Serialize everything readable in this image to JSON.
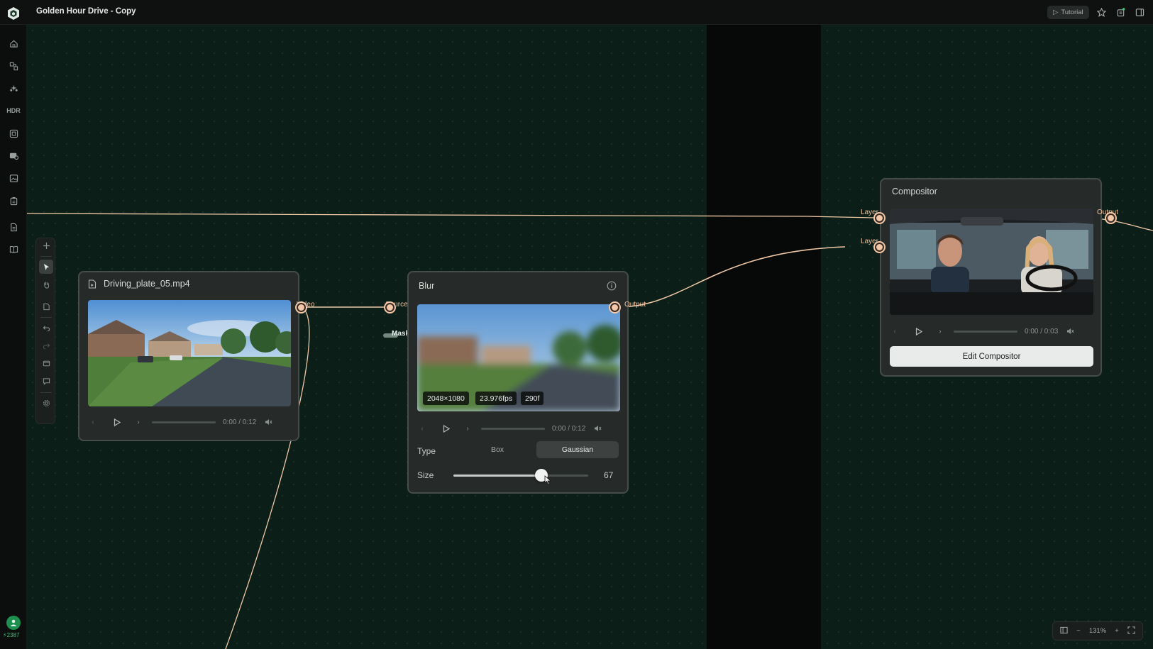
{
  "app": {
    "document_title": "Golden Hour Drive - Copy",
    "tutorial_label": "Tutorial",
    "credits": "2387"
  },
  "colors": {
    "canvas_bg": "#0b1f18",
    "wire": "#f0c8a6",
    "node_bg": "#262a28",
    "accent_green": "#1d8f4e"
  },
  "sidebar": {
    "items": [
      {
        "icon": "home-icon"
      },
      {
        "icon": "workflow-icon"
      },
      {
        "icon": "sparkle-nodes-icon"
      },
      {
        "icon": "hdr-icon",
        "label": "HDR"
      },
      {
        "icon": "frame-icon"
      },
      {
        "icon": "media-icon"
      },
      {
        "icon": "gallery-icon"
      },
      {
        "icon": "clipboard-icon"
      },
      {
        "icon": "document-icon"
      },
      {
        "icon": "book-icon"
      }
    ]
  },
  "nodes": {
    "video": {
      "title": "Driving_plate_05.mp4",
      "time": "0:00 / 0:12",
      "output_label": "Video"
    },
    "blur": {
      "title": "Blur",
      "source_label": "Source *",
      "mask_label": "Mask",
      "output_label": "Output",
      "badges": [
        "2048×1080",
        "23.976fps",
        "290f"
      ],
      "time": "0:00 / 0:12",
      "type_label": "Type",
      "type_options": [
        "Box",
        "Gaussian"
      ],
      "type_selected": "Gaussian",
      "size_label": "Size",
      "size_value": "67",
      "size_fraction": 0.65
    },
    "compositor": {
      "title": "Compositor",
      "layer1_label": "Layer 1",
      "layer2_label": "Layer 2",
      "output_label": "Output",
      "time": "0:00 / 0:03",
      "edit_button": "Edit Compositor"
    }
  },
  "zoom": {
    "level": "131%"
  }
}
